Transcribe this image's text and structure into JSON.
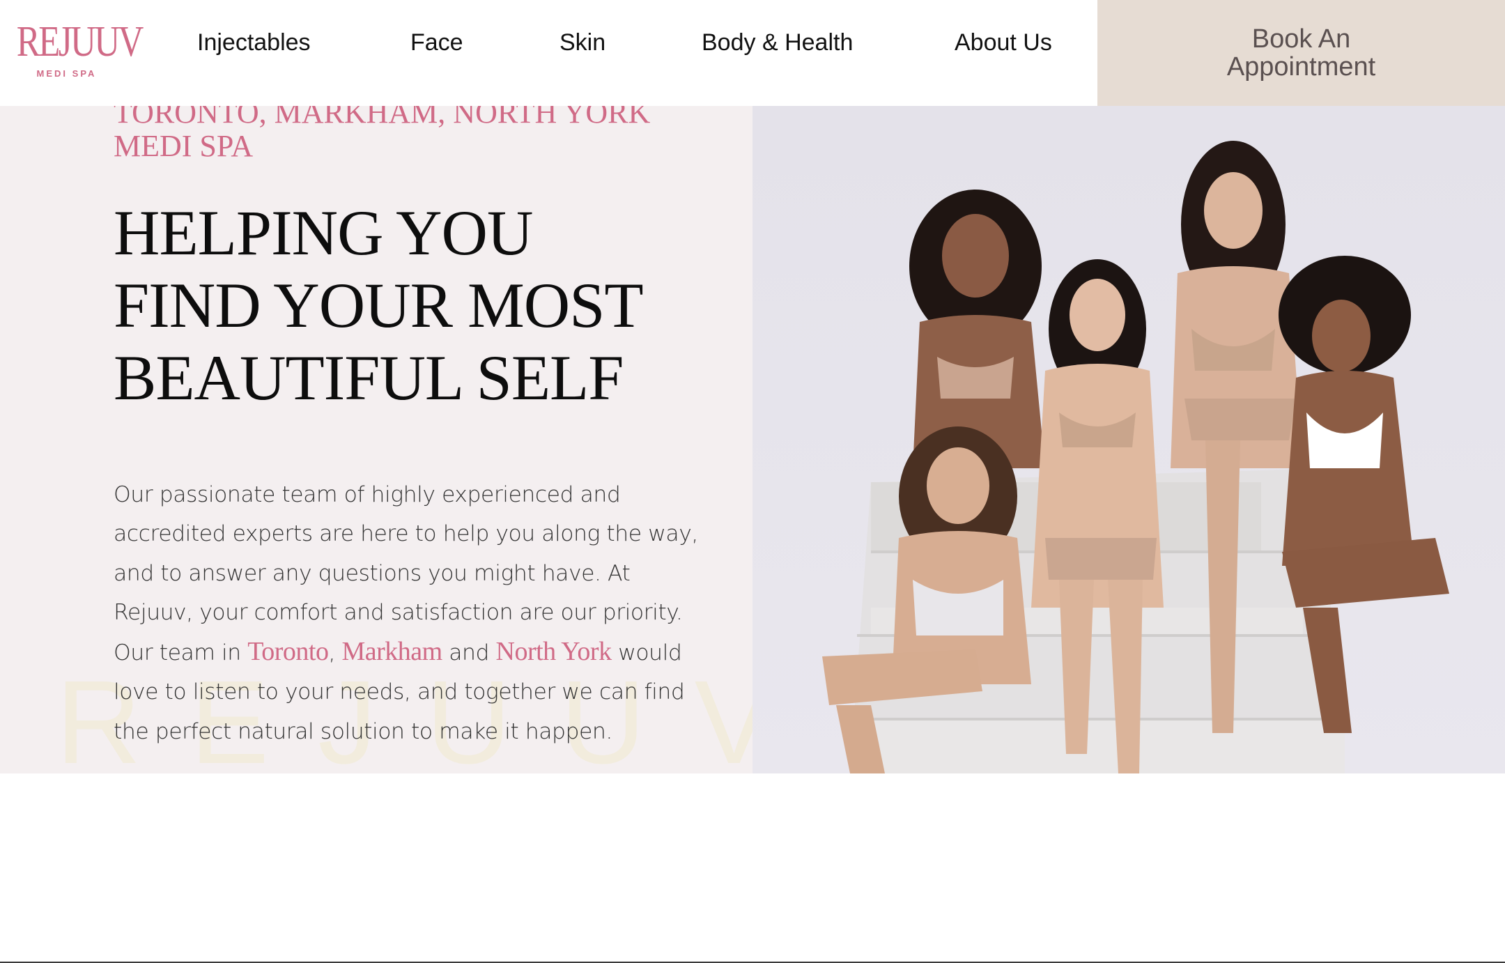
{
  "brand": {
    "logo_text": "REJUUV",
    "logo_sub": "MEDI SPA",
    "accent_color": "#d06a86"
  },
  "nav": {
    "items": [
      "Injectables",
      "Face",
      "Skin",
      "Body & Health",
      "About Us"
    ],
    "cta_line1": "Book An",
    "cta_line2": "Appointment",
    "cta_bg": "#e6dcd3"
  },
  "hero": {
    "eyebrow": "TORONTO, MARKHAM, NORTH YORK MEDI SPA",
    "headline_line1": "HELPING YOU",
    "headline_line2": "FIND YOUR MOST",
    "headline_line3": "BEAUTIFUL SELF",
    "body_part1": "Our passionate team of highly experienced and accredited experts are here to help you along the way, and to answer any questions you might have. At Rejuuv, your comfort and satisfaction are our priority. Our team in ",
    "city1": "Toronto",
    "sep1": ", ",
    "city2": "Markham",
    "sep2": " and ",
    "city3": "North York",
    "body_part2": " would love to listen to your needs, and together we can find the perfect natural solution to make it happen.",
    "watermark": "REJUUV",
    "image_name": "group-of-five-smiling-women-photo"
  }
}
